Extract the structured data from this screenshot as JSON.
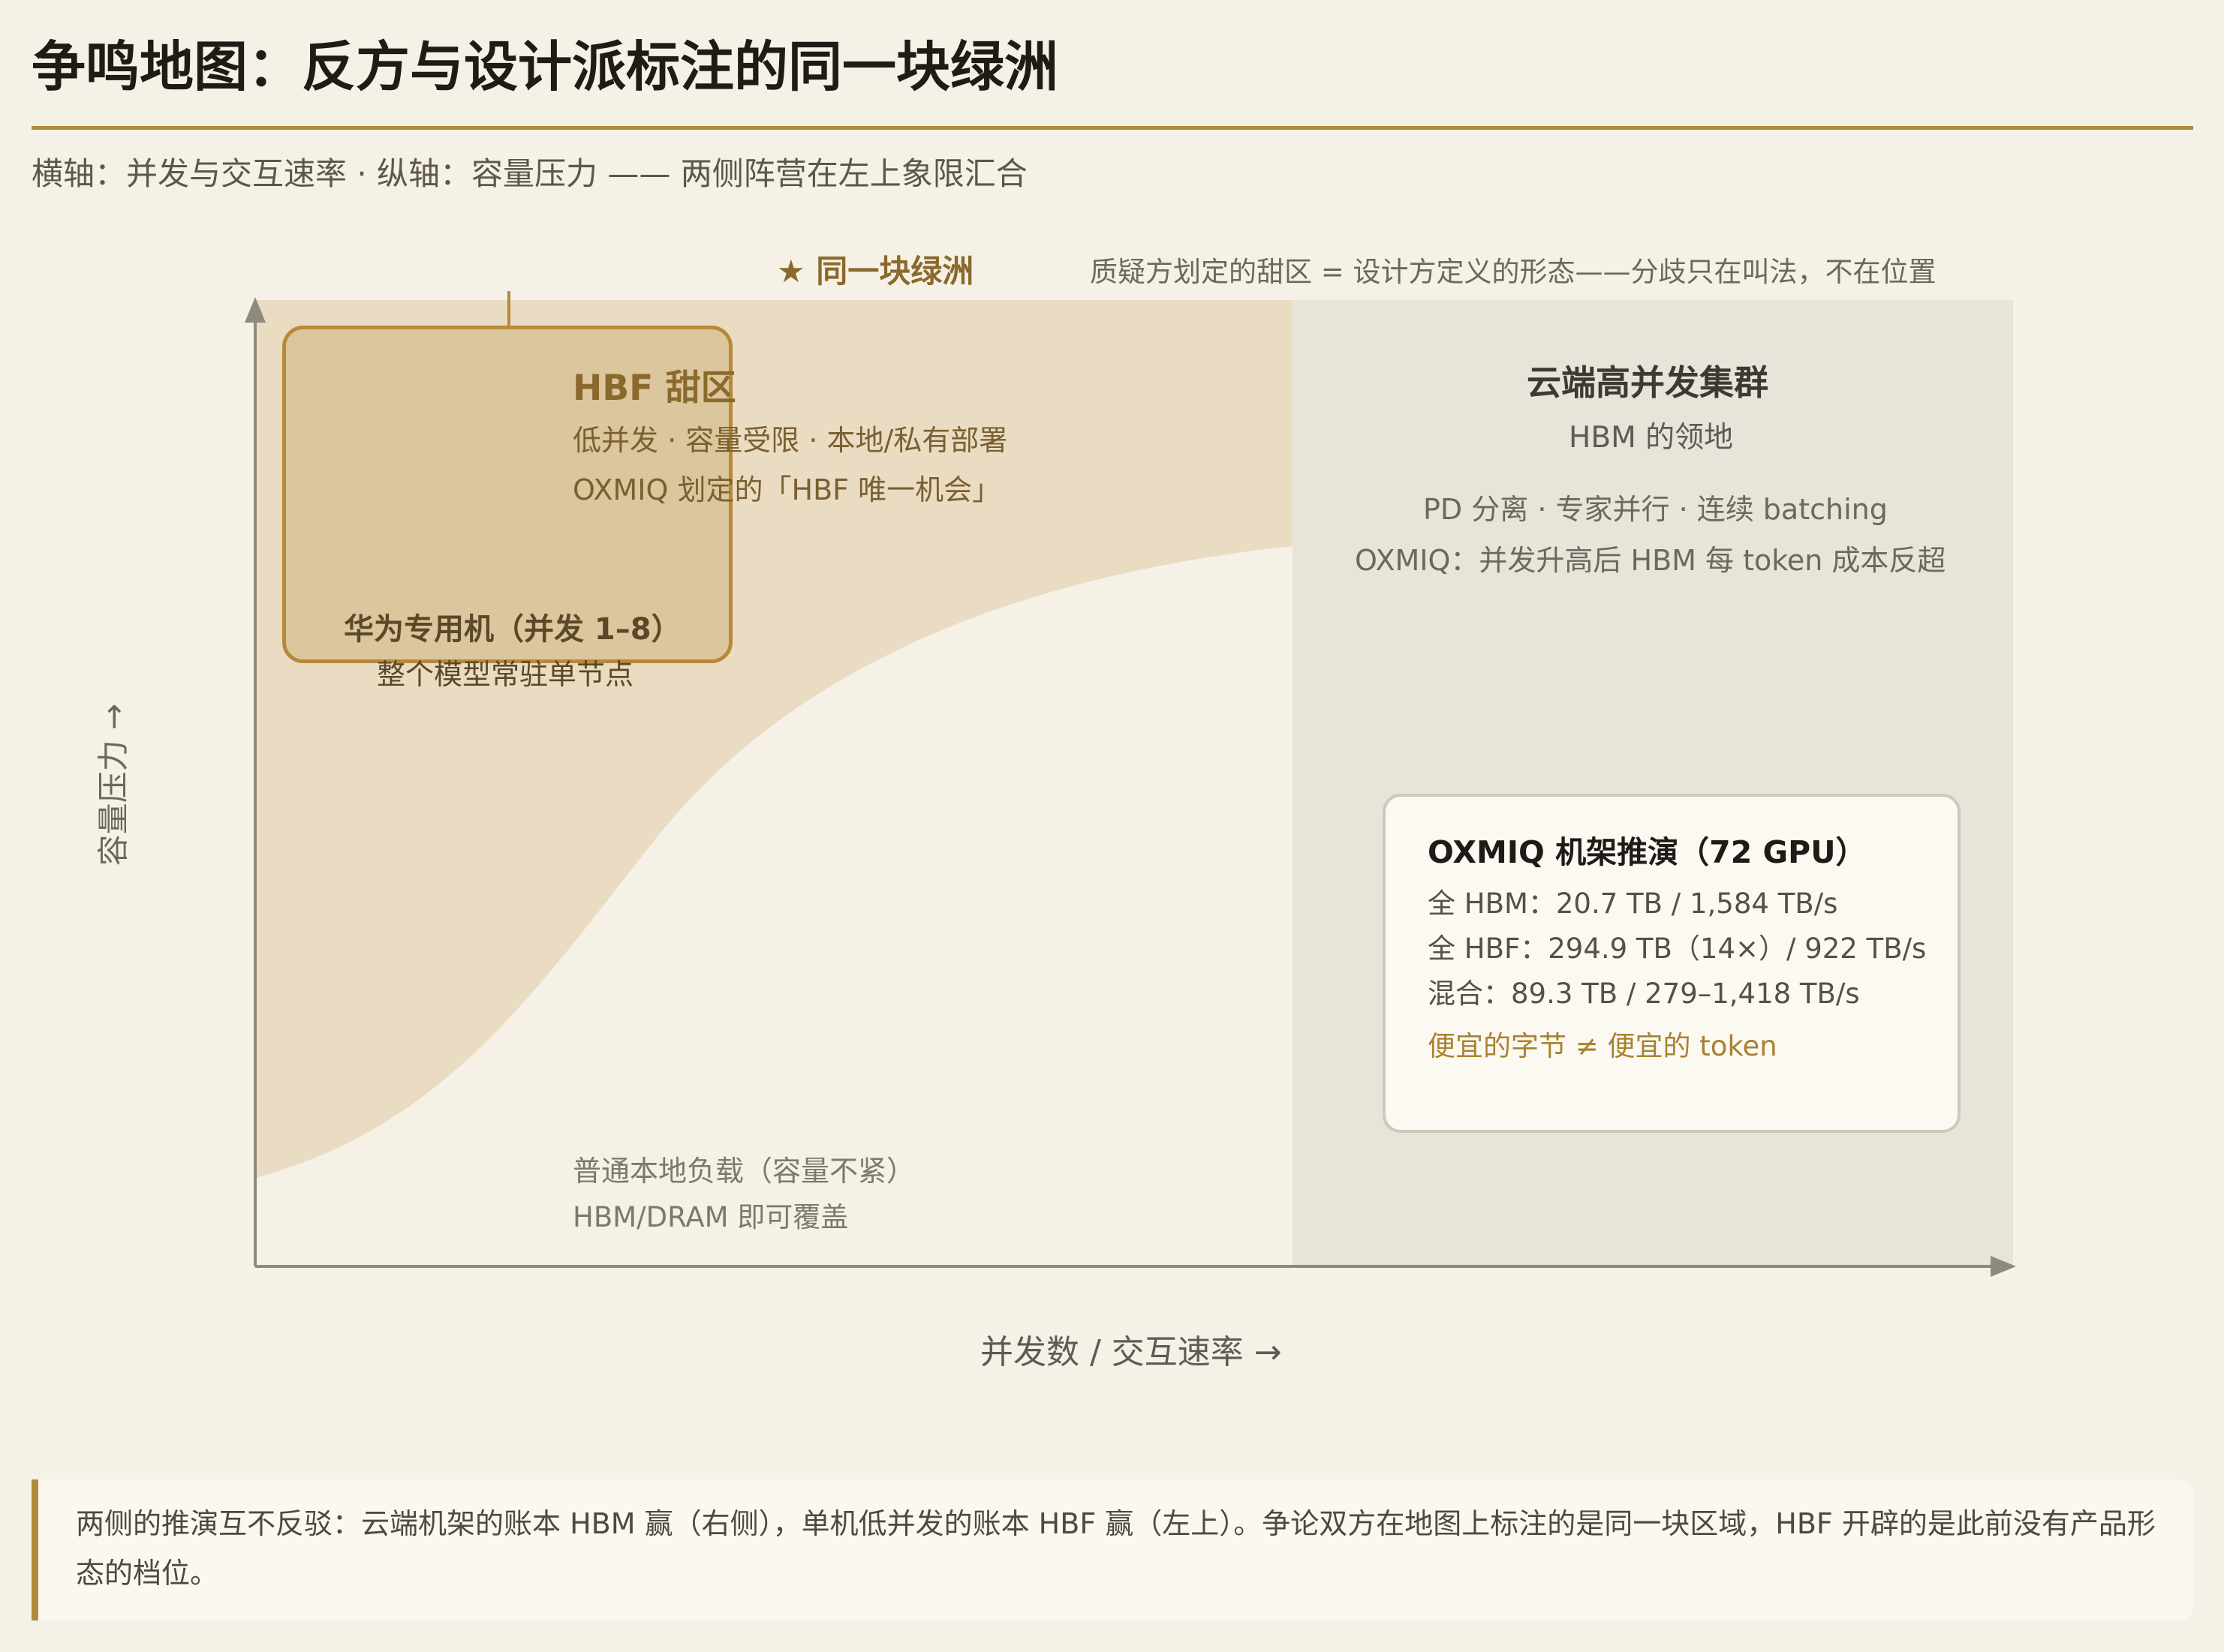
{
  "title": "争鸣地图：反方与设计派标注的同一块绿洲",
  "subtitle": "横轴：并发与交互速率 · 纵轴：容量压力 —— 两侧阵营在左上象限汇合",
  "oasis": {
    "label": "★ 同一块绿洲",
    "note": "质疑方划定的甜区 = 设计方定义的形态——分歧只在叫法，不在位置"
  },
  "hbf_zone": {
    "title": "HBF 甜区",
    "line1": "低并发 · 容量受限 · 本地/私有部署",
    "line2": "OXMIQ 划定的「HBF 唯一机会」"
  },
  "huawei": {
    "title": "华为专用机（并发 1–8）",
    "sub": "整个模型常驻单节点"
  },
  "cloud": {
    "title": "云端高并发集群",
    "sub": "HBM 的领地",
    "line1": "PD 分离 · 专家并行 · 连续 batching",
    "line2": "OXMIQ：并发升高后 HBM 每 token 成本反超"
  },
  "common": {
    "line1": "普通本地负载（容量不紧）",
    "line2": "HBM/DRAM 即可覆盖"
  },
  "rack": {
    "title": "OXMIQ 机架推演（72 GPU）",
    "rows": [
      "全 HBM：20.7 TB / 1,584 TB/s",
      "全 HBF：294.9 TB（14×）/ 922 TB/s",
      "混合：89.3 TB / 279–1,418 TB/s"
    ],
    "note": "便宜的字节 ≠ 便宜的 token"
  },
  "axes": {
    "y_label": "容量压力 →",
    "x_label": "并发数 / 交互速率 →"
  },
  "callout": "两侧的推演互不反驳：云端机架的账本 HBM 赢（右侧），单机低并发的账本 HBF 赢（左上）。争论双方在地图上标注的是同一块区域，HBF 开辟的是此前没有产品形态的档位。",
  "colors": {
    "accent": "#b08a3e",
    "hbf_region": "#e9dcc3",
    "cloud_region": "#e9e4da",
    "background": "#f6f1e6"
  }
}
